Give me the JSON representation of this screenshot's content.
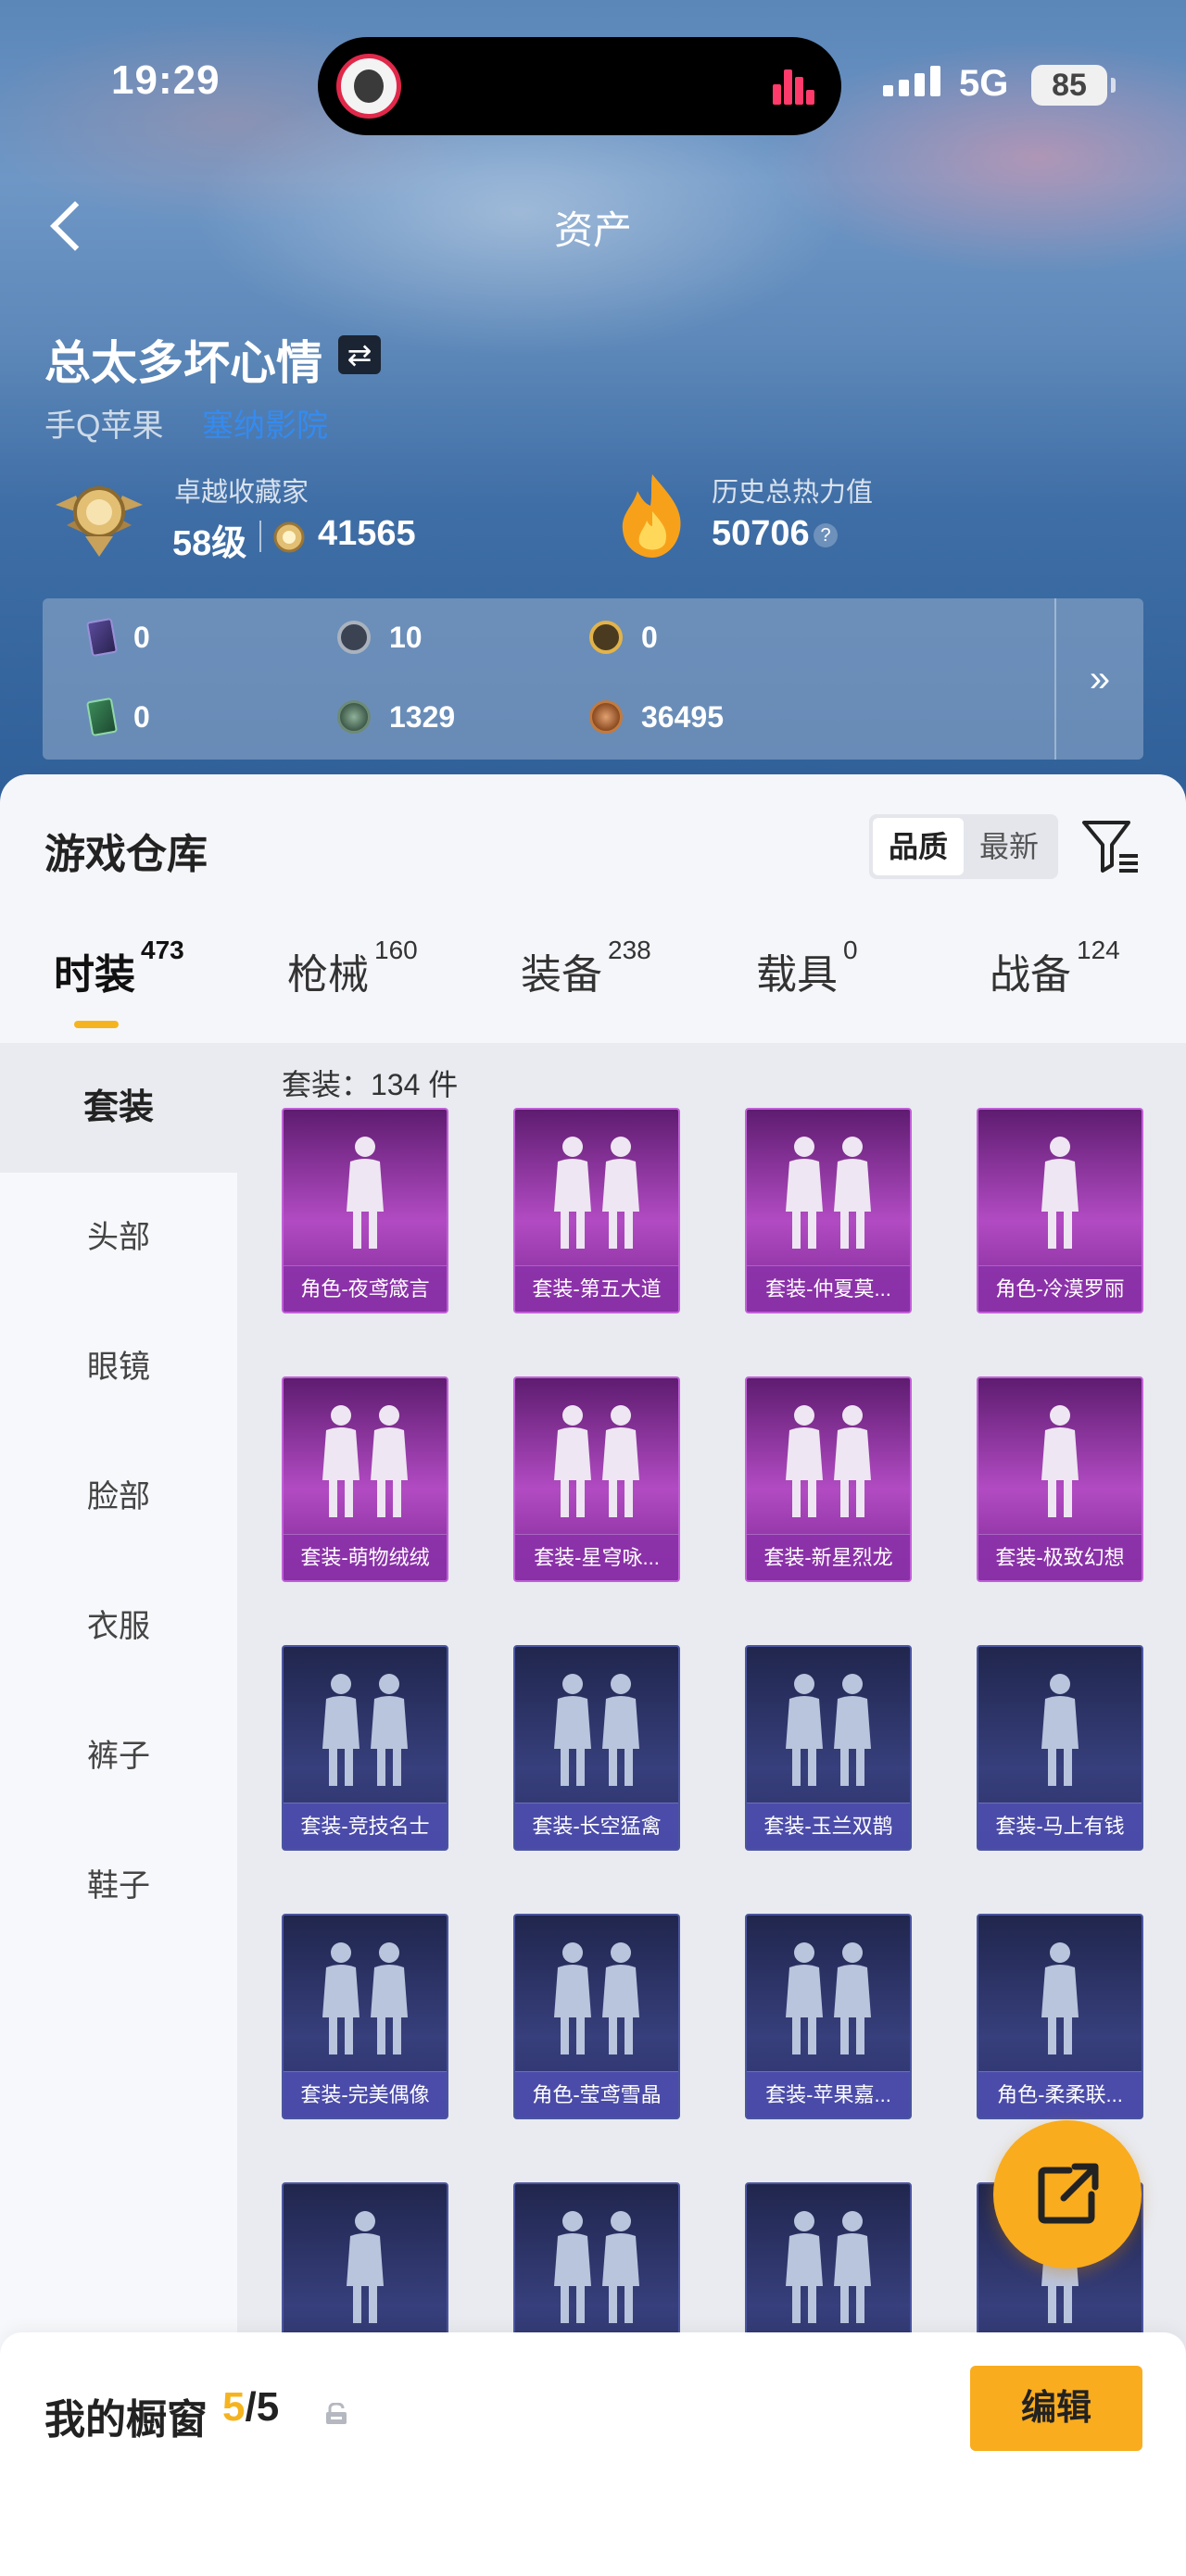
{
  "status": {
    "time": "19:29",
    "network": "5G",
    "battery": "85"
  },
  "nav": {
    "title": "资产"
  },
  "profile": {
    "name": "总太多坏心情",
    "platform": "手Q苹果",
    "region": "塞纳影院",
    "collector_label": "卓越收藏家",
    "collector_level": "58级",
    "collector_points": "41565",
    "heat_label": "历史总热力值",
    "heat_value": "50706"
  },
  "currencies": [
    {
      "icon": "card-icon",
      "value": "0"
    },
    {
      "icon": "silver-coin-icon",
      "value": "10"
    },
    {
      "icon": "gold-coin-icon",
      "value": "0"
    },
    {
      "icon": "ticket-icon",
      "value": "0"
    },
    {
      "icon": "green-coin-icon",
      "value": "1329"
    },
    {
      "icon": "bronze-coin-icon",
      "value": "36495"
    }
  ],
  "warehouse": {
    "title": "游戏仓库",
    "sort_options": [
      "品质",
      "最新"
    ],
    "tabs": [
      {
        "label": "时装",
        "count": "473"
      },
      {
        "label": "枪械",
        "count": "160"
      },
      {
        "label": "装备",
        "count": "238"
      },
      {
        "label": "载具",
        "count": "0"
      },
      {
        "label": "战备",
        "count": "124"
      }
    ],
    "categories": [
      "套装",
      "头部",
      "眼镜",
      "脸部",
      "衣服",
      "裤子",
      "鞋子"
    ],
    "section_label": "套装：134 件",
    "items": [
      {
        "name": "角色-夜鸢箴言",
        "rarity": "purple"
      },
      {
        "name": "套装-第五大道",
        "rarity": "purple"
      },
      {
        "name": "套装-仲夏莫...",
        "rarity": "purple"
      },
      {
        "name": "角色-冷漠罗丽",
        "rarity": "purple"
      },
      {
        "name": "套装-萌物绒绒",
        "rarity": "purple"
      },
      {
        "name": "套装-星穹咏...",
        "rarity": "purple"
      },
      {
        "name": "套装-新星烈龙",
        "rarity": "purple"
      },
      {
        "name": "套装-极致幻想",
        "rarity": "purple"
      },
      {
        "name": "套装-竞技名士",
        "rarity": "blue"
      },
      {
        "name": "套装-长空猛禽",
        "rarity": "blue"
      },
      {
        "name": "套装-玉兰双鹊",
        "rarity": "blue"
      },
      {
        "name": "套装-马上有钱",
        "rarity": "blue"
      },
      {
        "name": "套装-完美偶像",
        "rarity": "blue"
      },
      {
        "name": "角色-莹鸢雪晶",
        "rarity": "blue"
      },
      {
        "name": "套装-苹果嘉...",
        "rarity": "blue"
      },
      {
        "name": "角色-柔柔联...",
        "rarity": "blue"
      },
      {
        "name": "",
        "rarity": "blue"
      },
      {
        "name": "",
        "rarity": "blue"
      },
      {
        "name": "",
        "rarity": "blue"
      },
      {
        "name": "",
        "rarity": "blue"
      }
    ]
  },
  "showcase": {
    "title": "我的橱窗",
    "current": "5",
    "total": "/5",
    "edit_label": "编辑"
  },
  "colors": {
    "accent": "#f9ac1e",
    "purple_rarity": "#b24bc3",
    "blue_rarity": "#373f7c"
  }
}
